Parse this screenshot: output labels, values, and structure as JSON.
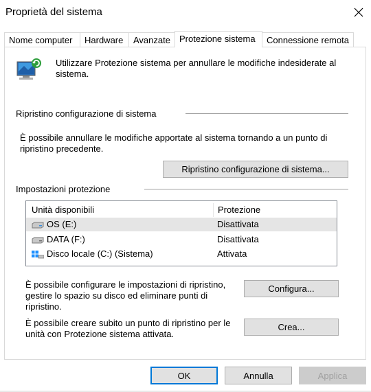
{
  "window": {
    "title": "Proprietà del sistema"
  },
  "tabs": [
    {
      "label": "Nome computer"
    },
    {
      "label": "Hardware"
    },
    {
      "label": "Avanzate"
    },
    {
      "label": "Protezione sistema",
      "active": true
    },
    {
      "label": "Connessione remota"
    }
  ],
  "intro": {
    "text": "Utilizzare Protezione sistema per annullare le modifiche indesiderate al sistema."
  },
  "restore": {
    "heading": "Ripristino configurazione di sistema",
    "description": "È possibile annullare le modifiche apportate al sistema tornando a un punto di ripristino precedente.",
    "button": "Ripristino configurazione di sistema..."
  },
  "protection": {
    "heading": "Impostazioni protezione",
    "columns": [
      "Unità disponibili",
      "Protezione"
    ],
    "rows": [
      {
        "drive": "OS (E:)",
        "status": "Disattivata",
        "icon": "drive-icon"
      },
      {
        "drive": "DATA (F:)",
        "status": "Disattivata",
        "icon": "drive-icon"
      },
      {
        "drive": "Disco locale (C:) (Sistema)",
        "status": "Attivata",
        "icon": "windows-drive-icon"
      }
    ],
    "configure_text": "È possibile configurare le impostazioni di ripristino, gestire lo spazio su disco ed eliminare punti di ripristino.",
    "configure_button": "Configura...",
    "create_text": "È possibile creare subito un punto di ripristino per le unità con Protezione sistema attivata.",
    "create_button": "Crea..."
  },
  "footer": {
    "ok": "OK",
    "cancel": "Annulla",
    "apply": "Applica"
  },
  "colors": {
    "accent": "#0078d7",
    "button": "#e1e1e1",
    "selected_row": "#e5e5e5"
  }
}
